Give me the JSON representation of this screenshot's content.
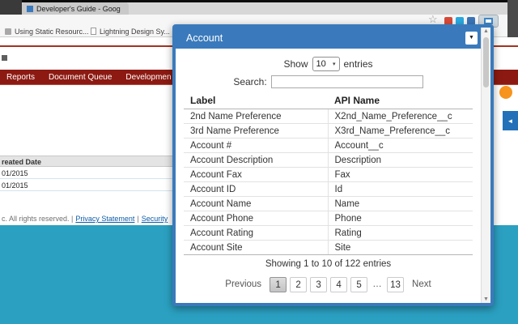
{
  "icons": {
    "dropdown_arrow": "▼",
    "small_dropdown_arrow": "▾",
    "scroll_up": "▲",
    "scroll_down": "▼",
    "star": "☆",
    "chevron_left": "◄"
  },
  "browser": {
    "tab_title": "Developer's Guide - Goog",
    "bookmarks": [
      "Using Static Resourc...",
      "Lightning Design Sy..."
    ]
  },
  "salesforce_page": {
    "nav_tabs": [
      "Reports",
      "Document Queue",
      "Developmen"
    ],
    "list_header": "reated Date",
    "list_rows": [
      "01/2015",
      "01/2015"
    ],
    "footer_prefix": "c. All rights reserved. |",
    "footer_links": [
      "Privacy Statement",
      "Security"
    ],
    "footer_separator": "|"
  },
  "popup": {
    "object_selector": {
      "value": "Account"
    },
    "length_control": {
      "show_label": "Show",
      "value": "10",
      "entries_label": "entries"
    },
    "search": {
      "label": "Search:",
      "value": ""
    },
    "table": {
      "columns": [
        "Label",
        "API Name"
      ],
      "rows": [
        [
          "2nd Name Preference",
          "X2nd_Name_Preference__c"
        ],
        [
          "3rd Name Preference",
          "X3rd_Name_Preference__c"
        ],
        [
          "Account #",
          "Account__c"
        ],
        [
          "Account Description",
          "Description"
        ],
        [
          "Account Fax",
          "Fax"
        ],
        [
          "Account ID",
          "Id"
        ],
        [
          "Account Name",
          "Name"
        ],
        [
          "Account Phone",
          "Phone"
        ],
        [
          "Account Rating",
          "Rating"
        ],
        [
          "Account Site",
          "Site"
        ]
      ]
    },
    "info_text": "Showing 1 to 10 of 122 entries",
    "pagination": {
      "previous_label": "Previous",
      "pages": [
        "1",
        "2",
        "3",
        "4",
        "5",
        "…",
        "13"
      ],
      "active_page": "1",
      "next_label": "Next"
    }
  },
  "colors": {
    "teal_background": "#2ba0c1",
    "popup_blue": "#3a7abc",
    "nav_maroon": "#8c1a12",
    "help_orange": "#f7941d"
  }
}
